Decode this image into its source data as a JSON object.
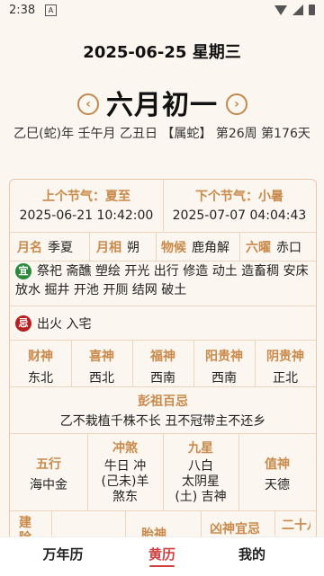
{
  "status_bar": {
    "time": "2:38",
    "notification_glyph": "A"
  },
  "header": {
    "gregorian_date": "2025-06-25 星期三",
    "lunar_date": "六月初一",
    "prev_icon": "‹",
    "next_icon": "›",
    "ganzhi_line": "乙巳(蛇)年 壬午月 乙丑日 【属蛇】 第26周 第176天"
  },
  "jieqi": {
    "prev_label": "上个节气：夏至",
    "prev_time": "2025-06-21 10:42:00",
    "next_label": "下个节气：小暑",
    "next_time": "2025-07-07 04:04:43"
  },
  "info": {
    "yueming_label": "月名",
    "yueming_value": "季夏",
    "yuexiang_label": "月相",
    "yuexiang_value": "朔",
    "wuhou_label": "物候",
    "wuhou_value": "鹿角解",
    "liuyao_label": "六曜",
    "liuyao_value": "赤口"
  },
  "yi": {
    "badge": "宜",
    "text": "祭祀 斋醮 塑绘 开光 出行 修造 动土 造畜稠 安床 放水 掘井 开池 开厕 结网 破土"
  },
  "ji": {
    "badge": "忌",
    "text": "出火 入宅"
  },
  "gods": [
    {
      "label": "财神",
      "value": "东北"
    },
    {
      "label": "喜神",
      "value": "西北"
    },
    {
      "label": "福神",
      "value": "西南"
    },
    {
      "label": "阳贵神",
      "value": "西南"
    },
    {
      "label": "阴贵神",
      "value": "正北"
    }
  ],
  "pengzu": {
    "title": "彭祖百忌",
    "text": "乙不栽植千株不长 丑不冠带主不还乡"
  },
  "wuxing": {
    "wuxing_label": "五行",
    "wuxing_value": "海中金",
    "chongsha_label": "冲煞",
    "chongsha_line1": "牛日 冲",
    "chongsha_line2": "(己未)羊",
    "chongsha_line3": "煞东",
    "jiuxing_label": "九星",
    "jiuxing_line1": "八白",
    "jiuxing_line2": "太阴星",
    "jiuxing_line3": "(土) 吉神",
    "zhishen_label": "值神",
    "zhishen_value": "天德"
  },
  "partial_row": {
    "jianchu_label": "建除",
    "taishen_label": "胎神",
    "xiongshen_label": "凶神宜忌",
    "ershiba_label": "二十八"
  },
  "tabs": [
    {
      "label": "万年历",
      "active": false
    },
    {
      "label": "黄历",
      "active": true
    },
    {
      "label": "我的",
      "active": false
    }
  ],
  "colors": {
    "accent_gold": "#c98a4b",
    "yi_green": "#2a8a3a",
    "ji_red": "#b62020",
    "active_tab": "#d04040"
  }
}
